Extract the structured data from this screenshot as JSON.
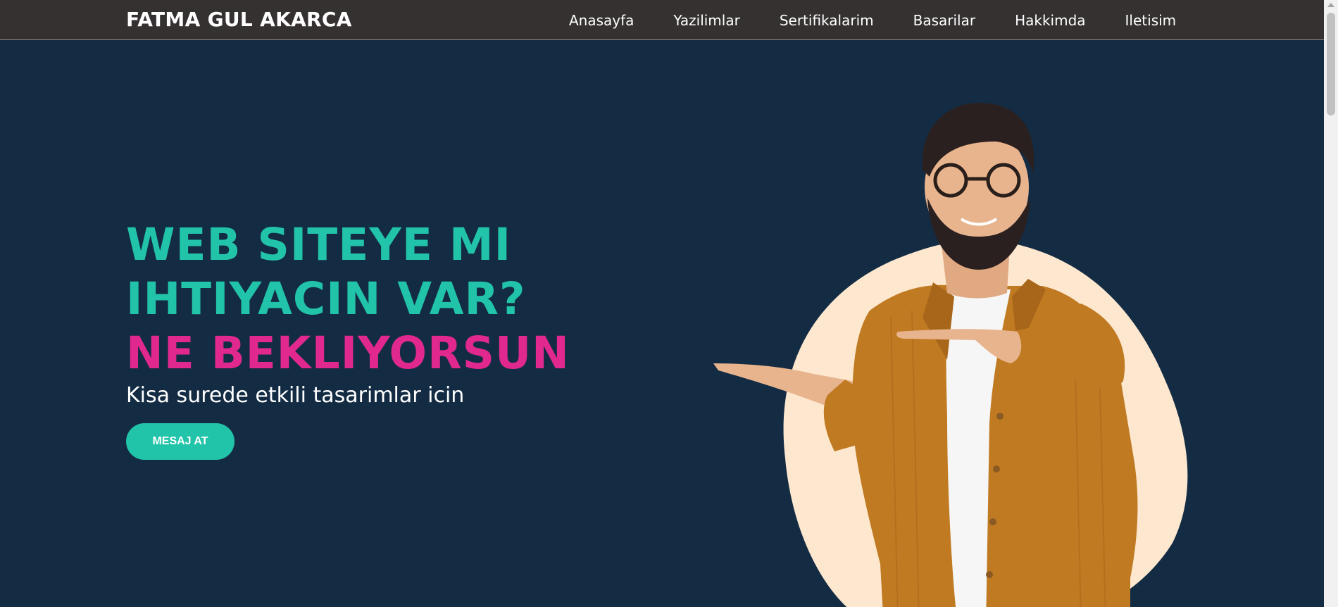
{
  "header": {
    "brand": "FATMA GUL AKARCA",
    "nav": [
      "Anasayfa",
      "Yazilimlar",
      "Sertifikalarim",
      "Basarilar",
      "Hakkimda",
      "Iletisim"
    ]
  },
  "hero": {
    "headline_line1": "WEB SITEYE MI",
    "headline_line2": "IHTIYACIN VAR?",
    "headline_line3": "NE BEKLIYORSUN",
    "subtitle": "Kisa surede etkili tasarimlar icin",
    "cta_label": "MESAJ AT"
  },
  "colors": {
    "navbar_bg": "#353131",
    "hero_bg": "#132c44",
    "accent_teal": "#22c4a9",
    "accent_pink": "#e0288f",
    "circle_bg": "#fde8cf",
    "jacket": "#c07a22"
  },
  "icons": {
    "hero_image": "man-pointing-illustration"
  }
}
